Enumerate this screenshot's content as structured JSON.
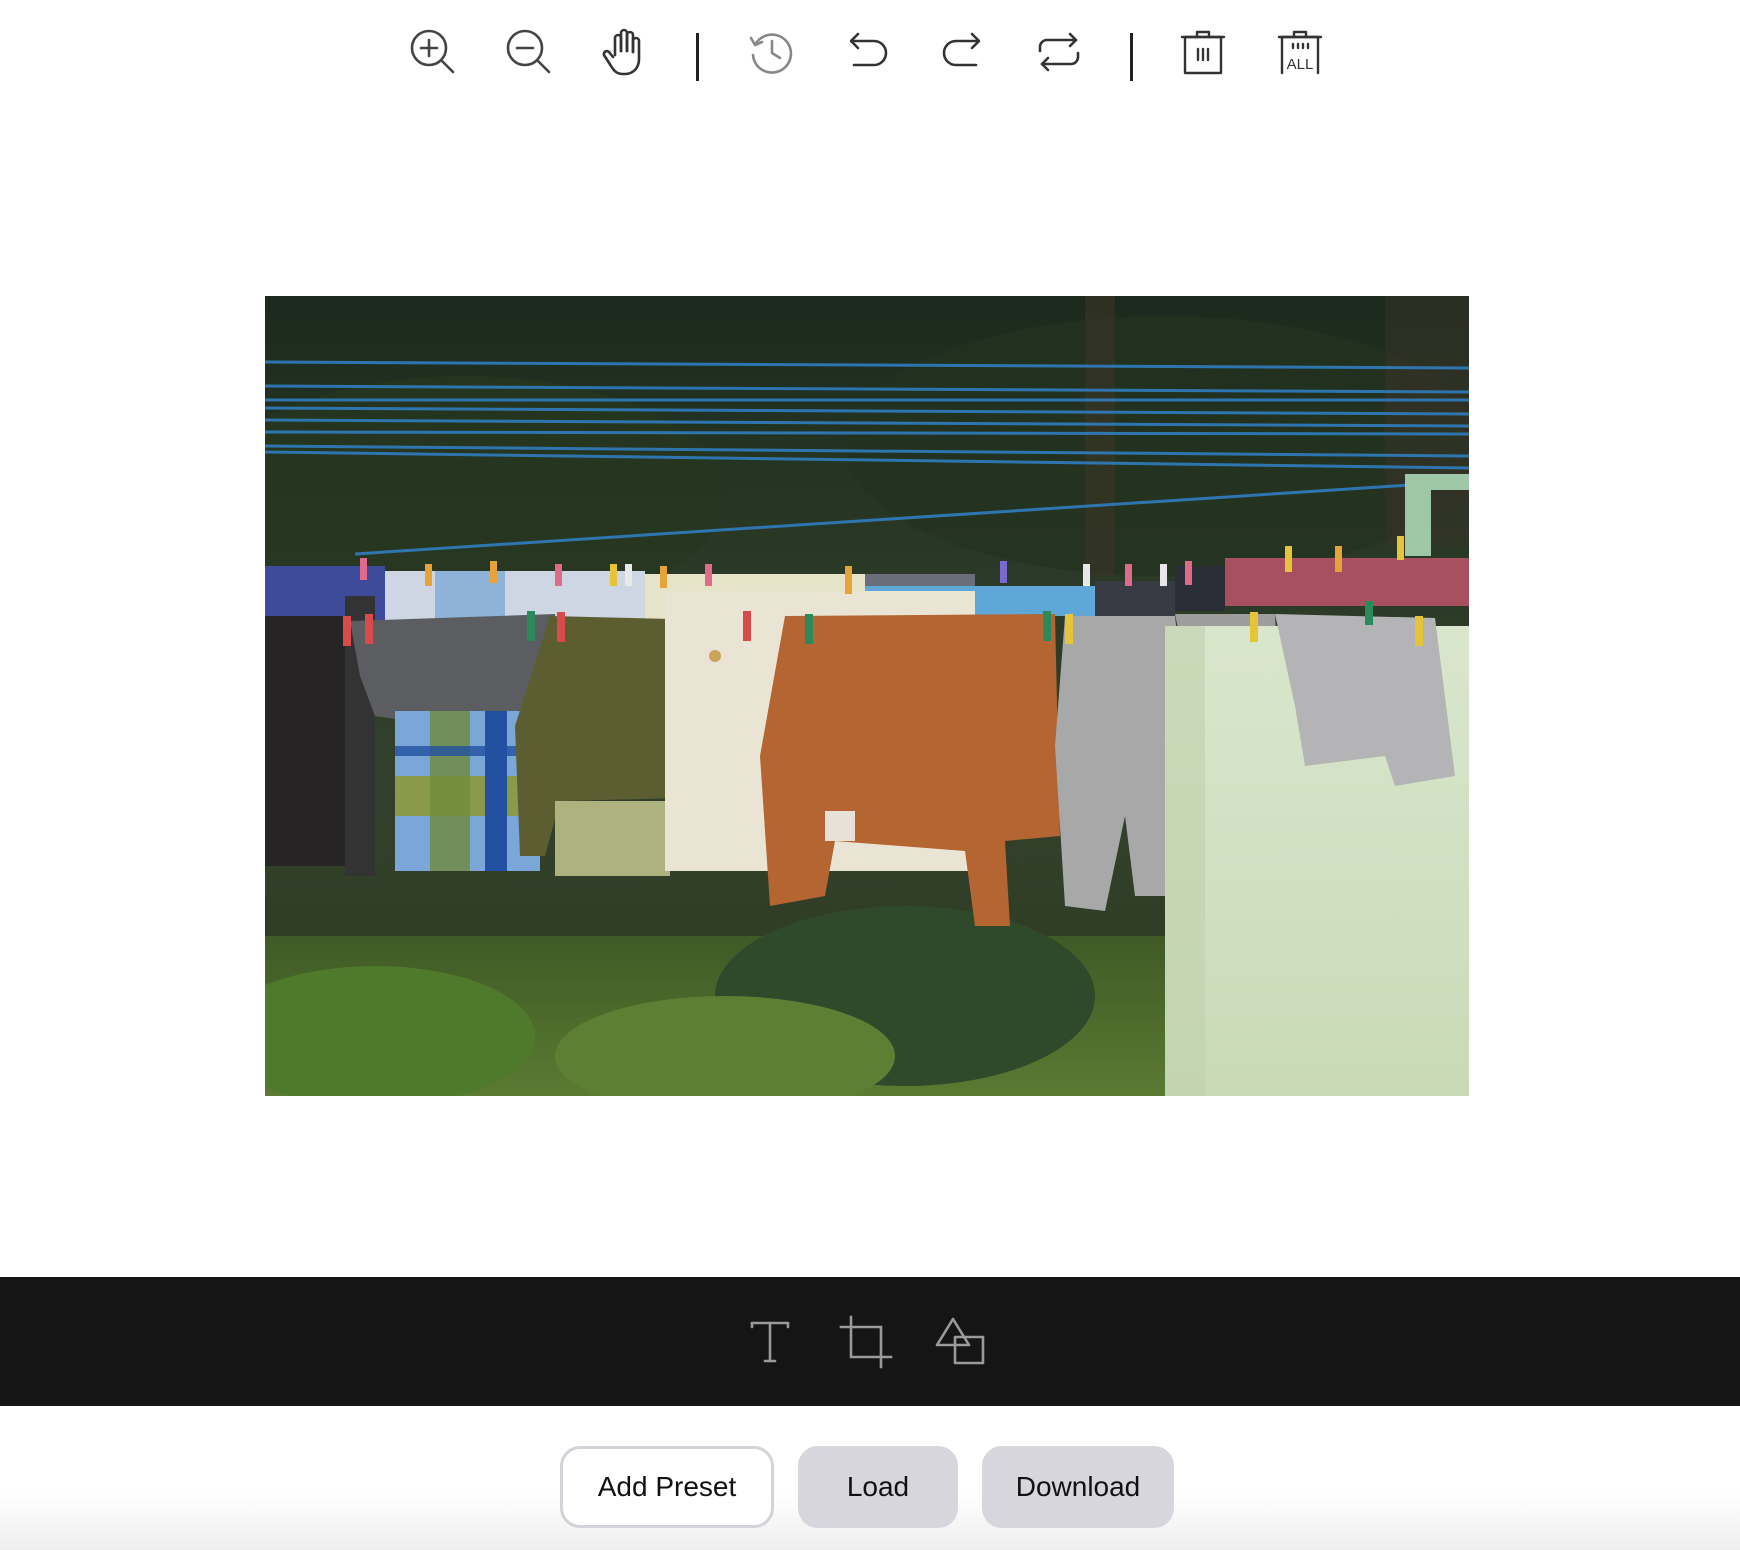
{
  "top_toolbar": {
    "items": [
      {
        "name": "zoom-in-icon",
        "label": "Zoom in"
      },
      {
        "name": "zoom-out-icon",
        "label": "Zoom out"
      },
      {
        "name": "hand-icon",
        "label": "Pan"
      },
      {
        "name": "history-icon",
        "label": "History"
      },
      {
        "name": "undo-icon",
        "label": "Undo"
      },
      {
        "name": "redo-icon",
        "label": "Redo"
      },
      {
        "name": "reset-icon",
        "label": "Reset"
      },
      {
        "name": "delete-icon",
        "label": "Delete"
      },
      {
        "name": "delete-all-icon",
        "label": "Delete all"
      }
    ],
    "delete_all_text": "ALL"
  },
  "canvas": {
    "image_subject": "laundry-on-clothesline-photo"
  },
  "tool_bar": {
    "background": "#151515",
    "items": [
      {
        "name": "text-tool-icon"
      },
      {
        "name": "crop-tool-icon"
      },
      {
        "name": "shape-tool-icon"
      }
    ]
  },
  "footer": {
    "add_preset_label": "Add Preset",
    "load_label": "Load",
    "download_label": "Download"
  }
}
